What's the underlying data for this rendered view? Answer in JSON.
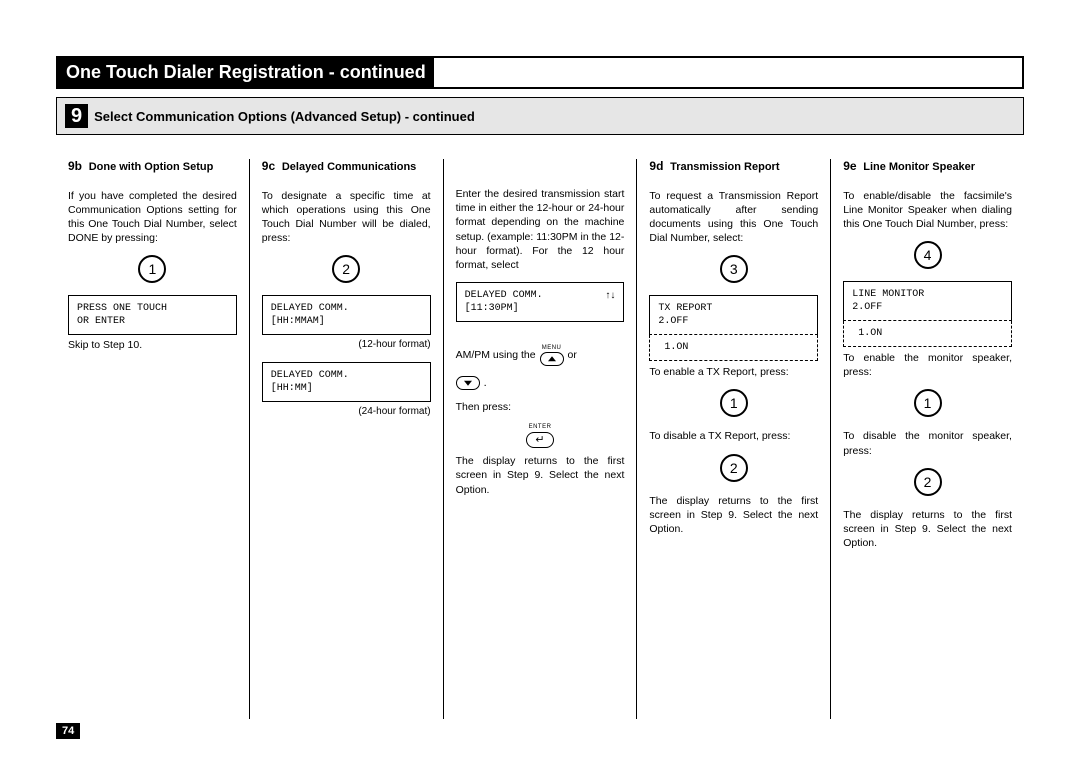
{
  "page_number": "74",
  "title": "One Touch Dialer Registration - continued",
  "subheader": {
    "number": "9",
    "text": "Select Communication Options (Advanced Setup) - continued"
  },
  "columns": {
    "b9": {
      "code": "9b",
      "title": "Done with Option Setup",
      "p1": "If you have completed the desired Communication Options setting for this One Touch Dial Number, select DONE by pressing:",
      "circle": "1",
      "lcd1_l1": "PRESS ONE TOUCH",
      "lcd1_l2": "OR ENTER",
      "note": "Skip to Step 10."
    },
    "c9": {
      "code": "9c",
      "title": "Delayed Communications",
      "p1": "To designate a specific time at which operations using this One Touch Dial Number will be dialed, press:",
      "circle": "2",
      "lcd1_l1": "DELAYED COMM.",
      "lcd1_l2": "[HH:MMAM]",
      "cap1": "(12-hour format)",
      "lcd2_l1": "DELAYED COMM.",
      "lcd2_l2": "[HH:MM]",
      "cap2": "(24-hour format)"
    },
    "c9b": {
      "p1": "Enter the desired transmission start time in either the 12-hour or 24-hour format depending on the machine setup. (example: 11:30PM in the 12-hour format). For the 12 hour format, select",
      "lcd1_l1": "DELAYED COMM.",
      "lcd1_l2": "[11:30PM]",
      "arrows": "↑↓",
      "p2a": "AM/PM using the",
      "p2b": "or",
      "p2c": ".",
      "menu_label": "MENU",
      "p3": "Then press:",
      "enter_label": "ENTER",
      "p4": "The display returns to the first screen in Step 9. Select the next Option."
    },
    "d9": {
      "code": "9d",
      "title": "Transmission Report",
      "p1": "To request a Transmission Report automatically after sending documents using this One Touch Dial Number, select:",
      "circle": "3",
      "lcd1_l1": "TX REPORT",
      "lcd1_l2": "2.OFF",
      "lcd2": " 1.ON",
      "p2": "To enable a TX Report, press:",
      "circle2": "1",
      "p3": "To disable a TX Report, press:",
      "circle3": "2",
      "p4": "The display returns to the first screen in Step 9. Select the next Option."
    },
    "e9": {
      "code": "9e",
      "title": "Line Monitor Speaker",
      "p1": "To enable/disable the facsimile's Line Monitor Speaker when dialing this One Touch Dial Number, press:",
      "circle": "4",
      "lcd1_l1": "LINE MONITOR",
      "lcd1_l2": "2.OFF",
      "lcd2": " 1.ON",
      "p2": "To enable the monitor speaker, press:",
      "circle2": "1",
      "p3": "To disable the monitor speaker, press:",
      "circle3": "2",
      "p4": "The display returns to the first screen in Step 9. Select the next Option."
    }
  }
}
